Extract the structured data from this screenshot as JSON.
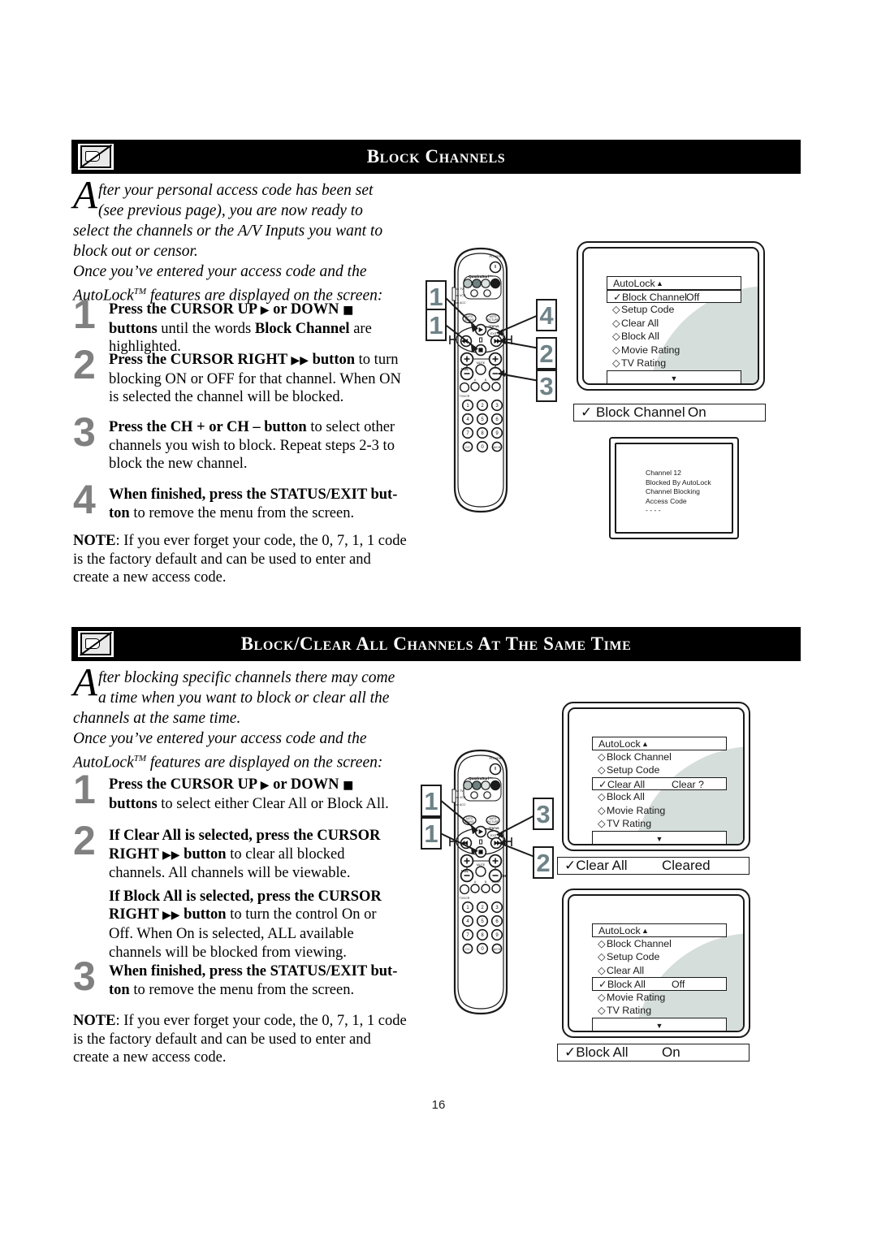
{
  "page": {
    "number": "16"
  },
  "sections": [
    {
      "id": "block-channels",
      "icon": "blocked-tv-icon",
      "title": "Block Channels",
      "intro": {
        "dropcap": "A",
        "line1": "fter your personal access code has been set",
        "line2": "(see previous page), you are now ready to",
        "rest": "select the channels or the A/V Inputs you want to block out or censor.",
        "rest2_a": "Once you’ve entered your access code and the",
        "rest2_b": "AutoLock",
        "rest2_tm": "TM",
        "rest2_c": " features are displayed on the screen:"
      },
      "steps": [
        {
          "num": "1",
          "bold1": "Press the CURSOR UP ",
          "glyph1": "▶",
          "bold2": " or DOWN ",
          "glyph2": "■",
          "bold3": " buttons",
          "plain": " until the words ",
          "boldmid": "Block Channel",
          "plain2": " are highlighted."
        },
        {
          "num": "2",
          "bold1": "Press the CURSOR RIGHT ",
          "glyph1": "▶▶",
          "bold3": " button",
          "plain": " to turn blocking ON or OFF for that channel. When ON is selected the channel will be blocked."
        },
        {
          "num": "3",
          "bold1": "Press the CH + or CH – button",
          "plain": " to select other channels you wish to block. Repeat steps 2-3 to block the new channel."
        },
        {
          "num": "4",
          "bold1": "When finished, press the STATUS/EXIT but-",
          "bold2": "ton",
          "plain": " to remove the menu from the screen."
        }
      ],
      "note": {
        "label": "NOTE",
        "sep": ": ",
        "text": "If you ever forget your code, the 0, 7, 1, 1 code is the factory default and can be used to enter and create a new access code."
      },
      "menu_screen": {
        "header": {
          "label": "AutoLock",
          "arrow": "▲"
        },
        "rows": [
          {
            "mark": "✓",
            "label": "Block Channel",
            "value": "Off",
            "selected": true
          },
          {
            "mark": "◇",
            "label": "Setup Code",
            "value": "",
            "selected": false
          },
          {
            "mark": "◇",
            "label": "Clear All",
            "value": "",
            "selected": false
          },
          {
            "mark": "◇",
            "label": "Block All",
            "value": "",
            "selected": false
          },
          {
            "mark": "◇",
            "label": "Movie Rating",
            "value": "",
            "selected": false
          },
          {
            "mark": "◇",
            "label": "TV Rating",
            "value": "",
            "selected": false
          }
        ],
        "footer_arrow": "▼"
      },
      "status_bar": {
        "mark": "✓",
        "label": "Block Channel",
        "value": "On"
      },
      "message_screen": {
        "lines": [
          "Channel 12",
          "Blocked By AutoLock",
          "Channel Blocking",
          "Access Code",
          "- - - -"
        ]
      },
      "remote_callouts": [
        "1",
        "1",
        "2",
        "3",
        "4"
      ]
    },
    {
      "id": "block-clear-all",
      "icon": "blocked-tv-icon",
      "title": "Block/Clear All Channels At The Same Time",
      "intro": {
        "dropcap": "A",
        "line1": "fter blocking specific channels there may come",
        "line2": "a time when you want to block or clear all the",
        "rest": "channels at the same time.",
        "rest2_a": "Once you’ve entered your access code and the",
        "rest2_b": "AutoLock",
        "rest2_tm": "TM",
        "rest2_c": " features are displayed on the screen:"
      },
      "steps": [
        {
          "num": "1",
          "bold1": "Press the CURSOR UP ",
          "glyph1": "▶",
          "bold2": " or DOWN ",
          "glyph2": "■",
          "bold3": " buttons",
          "plain": " to select either Clear All or Block All."
        },
        {
          "num": "2",
          "bold1": "If Clear All is selected, press the CURSOR RIGHT ",
          "glyph1": "▶▶",
          "bold3": " button",
          "plain": " to clear all blocked channels. All channels will be viewable.",
          "bold1b": "If Block All is selected, press the CURSOR RIGHT ",
          "glyph1b": "▶▶",
          "bold3b": " button",
          "plainb": " to turn the control On or Off. When On is selected, ALL available channels will be blocked from viewing."
        },
        {
          "num": "3",
          "bold1": "When finished, press the STATUS/EXIT but-",
          "bold2": "ton",
          "plain": " to remove the menu from the screen."
        }
      ],
      "note": {
        "label": "NOTE",
        "sep": ": ",
        "text": "If you ever forget your code, the 0, 7, 1, 1 code is the factory default and can be used to enter and create a new access code."
      },
      "menu_screen_top": {
        "header": {
          "label": "AutoLock",
          "arrow": "▲"
        },
        "rows": [
          {
            "mark": "◇",
            "label": "Block Channel",
            "value": "",
            "selected": false
          },
          {
            "mark": "◇",
            "label": "Setup Code",
            "value": "",
            "selected": false
          },
          {
            "mark": "✓",
            "label": "Clear All",
            "value": "Clear ?",
            "selected": true
          },
          {
            "mark": "◇",
            "label": "Block All",
            "value": "",
            "selected": false
          },
          {
            "mark": "◇",
            "label": "Movie Rating",
            "value": "",
            "selected": false
          },
          {
            "mark": "◇",
            "label": "TV Rating",
            "value": "",
            "selected": false
          }
        ],
        "footer_arrow": "▼"
      },
      "status_bar_top": {
        "mark": "✓",
        "label": "Clear All",
        "value": "Cleared"
      },
      "menu_screen_bottom": {
        "header": {
          "label": "AutoLock",
          "arrow": "▲"
        },
        "rows": [
          {
            "mark": "◇",
            "label": "Block Channel",
            "value": "",
            "selected": false
          },
          {
            "mark": "◇",
            "label": "Setup Code",
            "value": "",
            "selected": false
          },
          {
            "mark": "◇",
            "label": "Clear All",
            "value": "",
            "selected": false
          },
          {
            "mark": "✓",
            "label": "Block All",
            "value": "Off",
            "selected": true
          },
          {
            "mark": "◇",
            "label": "Movie Rating",
            "value": "",
            "selected": false
          },
          {
            "mark": "◇",
            "label": "TV Rating",
            "value": "",
            "selected": false
          }
        ],
        "footer_arrow": "▼"
      },
      "status_bar_bottom": {
        "mark": "✓",
        "label": "Block All",
        "value": "On"
      },
      "remote_callouts": [
        "1",
        "1",
        "2",
        "3"
      ]
    }
  ],
  "remote": {
    "power_label": "POWER",
    "brand_label": "QuadraSurf™",
    "side_labels": [
      "TV",
      "VCR",
      "ACC"
    ],
    "auto_sound": "AUTO SOUND",
    "auto_picture": "AUTO PICTURE",
    "status_exit": "STATUS EXIT",
    "vol_label": "VOL",
    "ch_label": "CH",
    "mute_label": "MUTE",
    "sleep_label": "SLEEP",
    "tv_vcr_label": "TV/VCR",
    "keys": [
      "1",
      "2",
      "3",
      "4",
      "5",
      "6",
      "7",
      "8",
      "9",
      "CC",
      "0",
      "A/CH"
    ]
  },
  "colors": {
    "header_bg": "#000000",
    "header_text": "#ffffff",
    "step_number": "#808080",
    "callout_number": "#6e8287",
    "swoosh": "#d5dedb"
  }
}
